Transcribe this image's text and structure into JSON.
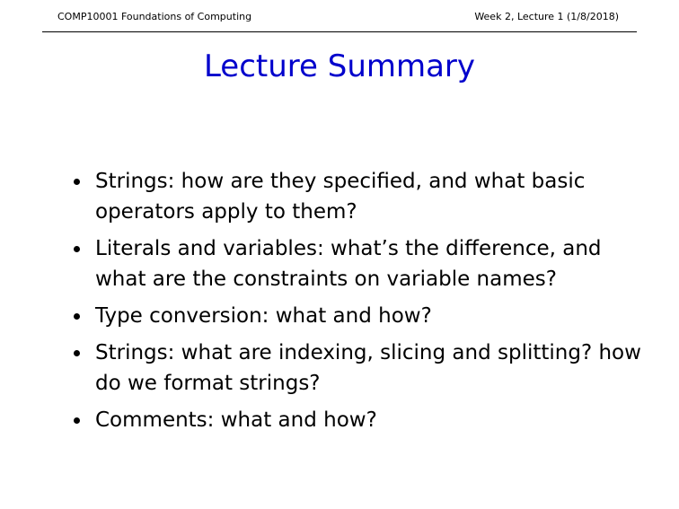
{
  "header": {
    "left": "COMP10001 Foundations of Computing",
    "right": "Week 2, Lecture 1 (1/8/2018)"
  },
  "slide": {
    "title": "Lecture Summary",
    "bullets": [
      "Strings: how are they specified, and what basic operators apply to them?",
      "Literals and variables: what’s the difference, and what are the constraints on variable names?",
      "Type conversion: what and how?",
      "Strings: what are indexing, slicing and splitting? how do we format strings?",
      "Comments: what and how?"
    ]
  },
  "colors": {
    "title": "#0000cc",
    "text": "#000000",
    "background": "#ffffff"
  }
}
